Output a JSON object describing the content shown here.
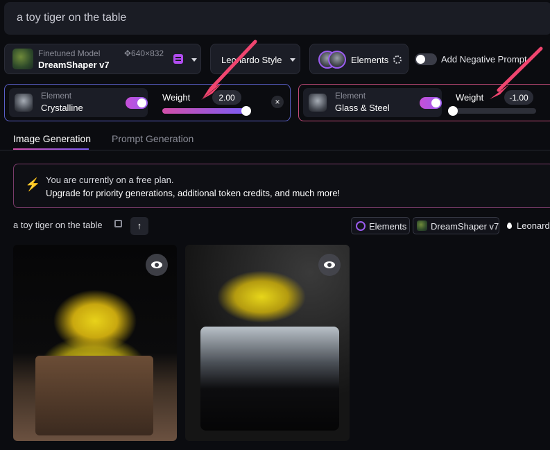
{
  "prompt_bar": {
    "text": "a toy tiger on the table"
  },
  "model": {
    "label": "Finetuned Model",
    "name": "DreamShaper v7",
    "dims": "✥640×832"
  },
  "style": {
    "label": "Leonardo Style"
  },
  "elements_btn": {
    "label": "Elements"
  },
  "negative_prompt": {
    "label": "Add Negative Prompt",
    "enabled": false
  },
  "element_rows": [
    {
      "label": "Element",
      "name": "Crystalline",
      "enabled": true,
      "weight_label": "Weight",
      "weight": "2.00",
      "weight_fraction": 1.0
    },
    {
      "label": "Element",
      "name": "Glass & Steel",
      "enabled": true,
      "weight_label": "Weight",
      "weight": "-1.00",
      "weight_fraction": 0.0
    }
  ],
  "close_glyph": "×",
  "tabs": [
    {
      "label": "Image Generation",
      "active": true
    },
    {
      "label": "Prompt Generation",
      "active": false
    }
  ],
  "notice": {
    "line1": "You are currently on a free plan.",
    "line2": "Upgrade for priority generations, additional token credits, and much more!"
  },
  "generation": {
    "prompt": "a toy tiger on the table",
    "tags": {
      "elements": "Elements",
      "model": "DreamShaper v7",
      "style": "Leonardo"
    }
  },
  "colors": {
    "accent_pink": "#d24fa9",
    "accent_purple": "#7c5cf5",
    "annotation_arrow": "#f0456f",
    "background": "#0b0c10"
  },
  "icons": {
    "bolt": "⚡",
    "upload": "↑"
  }
}
